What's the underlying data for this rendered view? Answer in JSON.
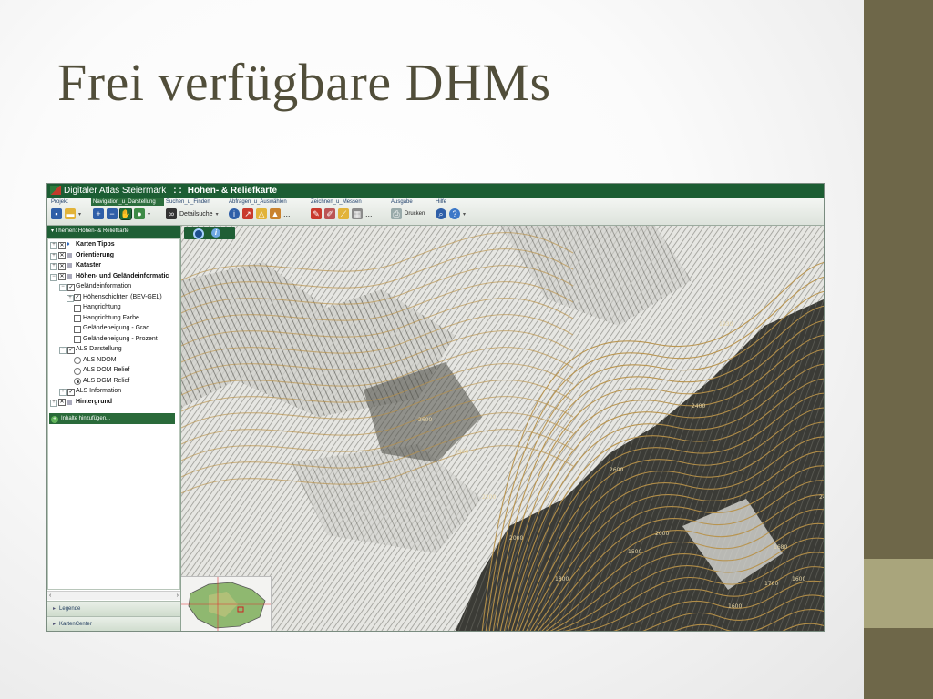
{
  "slide": {
    "title": "Frei verfügbare DHMs"
  },
  "colors": {
    "band_dark": "#6e6749",
    "band_light": "#a9a57c",
    "title": "#514e3a",
    "app_green": "#1c5d33",
    "contour": "#b8924a"
  },
  "app": {
    "name": "Digitaler Atlas Steiermark",
    "separator": ": :",
    "subtitle": "Höhen- & Reliefkarte"
  },
  "ribbon": {
    "groups": [
      {
        "label": "Projekt",
        "icons": [
          "save-icon",
          "open-folder-icon"
        ]
      },
      {
        "label": "Navigation_u_Darstellung",
        "icons": [
          "zoom-in-icon",
          "zoom-out-icon",
          "pan-hand-icon",
          "turtle-icon"
        ]
      },
      {
        "label": "Suchen_u_Finden",
        "button": "Detailsuche",
        "icons": [
          "binoculars-icon"
        ]
      },
      {
        "label": "Abfragen_u_Auswählen",
        "icons": [
          "info-icon",
          "select-icon",
          "profile-icon",
          "terrain-icon"
        ]
      },
      {
        "label": "Zeichnen_u_Messen",
        "icons": [
          "draw-icon",
          "edit-icon",
          "measure-icon",
          "grid-icon"
        ]
      },
      {
        "label": "Ausgabe",
        "button": "Drucken",
        "icons": [
          "printer-icon"
        ]
      },
      {
        "label": "Hilfe",
        "icons": [
          "search-help-icon",
          "help-icon"
        ]
      }
    ],
    "more": "..."
  },
  "sidebar": {
    "themes_header": "Themen: Höhen- & Reliefkarte",
    "tree": [
      {
        "label": "Karten Tipps",
        "bold": true,
        "level": 0,
        "control": "pin"
      },
      {
        "label": "Orientierung",
        "bold": true,
        "level": 0,
        "control": "x"
      },
      {
        "label": "Kataster",
        "bold": true,
        "level": 0,
        "control": "x"
      },
      {
        "label": "Höhen- und Geländeinformatic",
        "bold": true,
        "level": 0,
        "control": "x",
        "expanded": true
      },
      {
        "label": "Geländeinformation",
        "level": 1,
        "control": "check",
        "checked": true,
        "expanded": true
      },
      {
        "label": "Höhenschichten (BEV-GEL)",
        "level": 2,
        "control": "check",
        "checked": true
      },
      {
        "label": "Hangrichtung",
        "level": 2,
        "control": "check",
        "checked": false
      },
      {
        "label": "Hangrichtung Farbe",
        "level": 2,
        "control": "check",
        "checked": false
      },
      {
        "label": "Geländeneigung - Grad",
        "level": 2,
        "control": "check",
        "checked": false
      },
      {
        "label": "Geländeneigung - Prozent",
        "level": 2,
        "control": "check",
        "checked": false
      },
      {
        "label": "ALS Darstellung",
        "level": 1,
        "control": "check",
        "checked": true,
        "expanded": true
      },
      {
        "label": "ALS NDOM",
        "level": 2,
        "control": "radio",
        "checked": false
      },
      {
        "label": "ALS DOM Relief",
        "level": 2,
        "control": "radio",
        "checked": false
      },
      {
        "label": "ALS DGM Relief",
        "level": 2,
        "control": "radio",
        "checked": true
      },
      {
        "label": "ALS Information",
        "level": 1,
        "control": "check",
        "checked": true
      },
      {
        "label": "Hintergrund",
        "bold": true,
        "level": 0,
        "control": "x"
      }
    ],
    "add_button": "Inhalte hinzufügen...",
    "panels": [
      "Legende",
      "KartenCenter"
    ]
  },
  "map": {
    "contour_labels": [
      "2600",
      "2400",
      "2200",
      "2000",
      "1800",
      "2600",
      "2000",
      "1600",
      "1700",
      "1600",
      "1500",
      "1680",
      "2400",
      "2400",
      "1930"
    ]
  }
}
